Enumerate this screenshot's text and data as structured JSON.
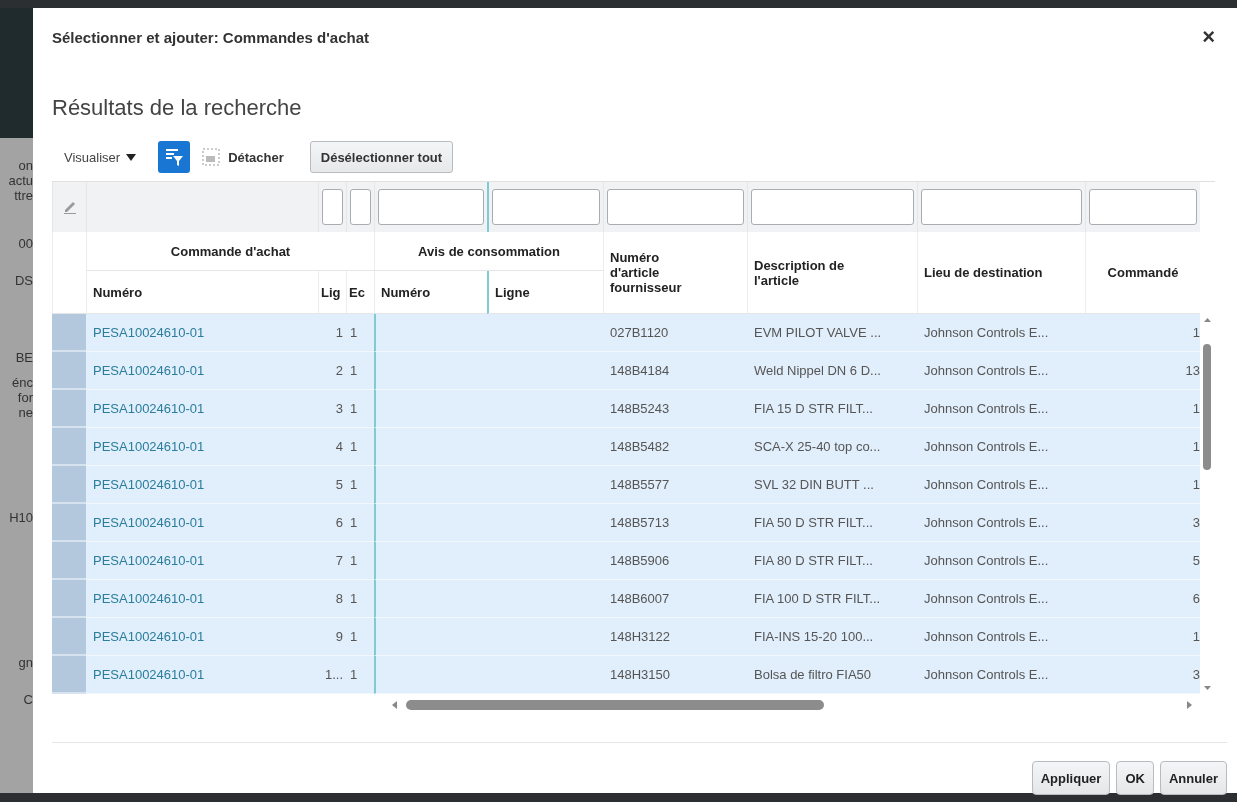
{
  "background_fragments": [
    "on",
    "actu",
    "ttre",
    "00",
    "DS",
    "BE",
    "énc",
    "for",
    "ne",
    "H10",
    "gn",
    "C"
  ],
  "dialog": {
    "title": "Sélectionner et ajouter: Commandes d'achat",
    "close": "×"
  },
  "heading": "Résultats de la recherche",
  "toolbar": {
    "view_menu": "Visualiser",
    "filter_toggle": {
      "on": true
    },
    "detach": "Détacher",
    "deselect_all": "Désélectionner tout"
  },
  "table": {
    "column_groups": [
      {
        "label": "Commande d'achat",
        "columns": [
          "Numéro",
          "Lig",
          "Ec"
        ]
      },
      {
        "label": "Avis de consommation",
        "columns": [
          "Numéro",
          "Ligne"
        ]
      }
    ],
    "columns": [
      "Numéro d'article fournisseur",
      "Description de l'article",
      "Lieu de destination",
      "Commandé"
    ],
    "rows": [
      {
        "selected": true,
        "po_number": "PESA10024610-01",
        "po_line": "1",
        "schedule": "1",
        "article": "027B1120",
        "description": "EVM PILOT VALVE ...",
        "destination": "Johnson Controls E...",
        "ordered": "1"
      },
      {
        "selected": true,
        "po_number": "PESA10024610-01",
        "po_line": "2",
        "schedule": "1",
        "article": "148B4184",
        "description": "Weld Nippel DN 6 D...",
        "destination": "Johnson Controls E...",
        "ordered": "13"
      },
      {
        "selected": true,
        "po_number": "PESA10024610-01",
        "po_line": "3",
        "schedule": "1",
        "article": "148B5243",
        "description": "FIA 15 D STR FILT...",
        "destination": "Johnson Controls E...",
        "ordered": "1"
      },
      {
        "selected": true,
        "po_number": "PESA10024610-01",
        "po_line": "4",
        "schedule": "1",
        "article": "148B5482",
        "description": "SCA-X 25-40 top co...",
        "destination": "Johnson Controls E...",
        "ordered": "1"
      },
      {
        "selected": true,
        "po_number": "PESA10024610-01",
        "po_line": "5",
        "schedule": "1",
        "article": "148B5577",
        "description": "SVL 32 DIN BUTT ...",
        "destination": "Johnson Controls E...",
        "ordered": "1"
      },
      {
        "selected": true,
        "po_number": "PESA10024610-01",
        "po_line": "6",
        "schedule": "1",
        "article": "148B5713",
        "description": "FIA 50 D STR FILT...",
        "destination": "Johnson Controls E...",
        "ordered": "3"
      },
      {
        "selected": true,
        "po_number": "PESA10024610-01",
        "po_line": "7",
        "schedule": "1",
        "article": "148B5906",
        "description": "FIA 80 D STR FILT...",
        "destination": "Johnson Controls E...",
        "ordered": "5"
      },
      {
        "selected": true,
        "po_number": "PESA10024610-01",
        "po_line": "8",
        "schedule": "1",
        "article": "148B6007",
        "description": "FIA 100 D STR FILT...",
        "destination": "Johnson Controls E...",
        "ordered": "6"
      },
      {
        "selected": true,
        "po_number": "PESA10024610-01",
        "po_line": "9",
        "schedule": "1",
        "article": "148H3122",
        "description": "FIA-INS 15-20 100...",
        "destination": "Johnson Controls E...",
        "ordered": "1"
      },
      {
        "selected": true,
        "po_number": "PESA10024610-01",
        "po_line": "1...",
        "schedule": "1",
        "article": "148H3150",
        "description": "Bolsa de filtro FIA50",
        "destination": "Johnson Controls E...",
        "ordered": "3"
      }
    ]
  },
  "buttons": [
    "Appliquer",
    "OK",
    "Annuler"
  ]
}
